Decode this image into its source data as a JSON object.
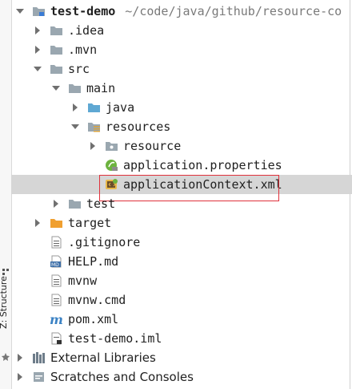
{
  "project": {
    "name": "test-demo",
    "path": "~/code/java/github/resource-co"
  },
  "tree": [
    {
      "label": "test-demo",
      "expanded": true,
      "icon": "module-folder-icon"
    },
    {
      "label": ".idea",
      "expanded": false,
      "icon": "folder-icon"
    },
    {
      "label": ".mvn",
      "expanded": false,
      "icon": "folder-icon"
    },
    {
      "label": "src",
      "expanded": true,
      "icon": "folder-icon"
    },
    {
      "label": "main",
      "expanded": true,
      "icon": "folder-icon"
    },
    {
      "label": "java",
      "expanded": false,
      "icon": "source-folder-icon"
    },
    {
      "label": "resources",
      "expanded": true,
      "icon": "resources-folder-icon"
    },
    {
      "label": "resource",
      "expanded": false,
      "icon": "package-folder-icon"
    },
    {
      "label": "application.properties",
      "icon": "spring-properties-icon"
    },
    {
      "label": "applicationContext.xml",
      "icon": "spring-xml-icon",
      "selected": true
    },
    {
      "label": "test",
      "expanded": false,
      "icon": "folder-icon"
    },
    {
      "label": "target",
      "expanded": false,
      "icon": "excluded-folder-icon"
    },
    {
      "label": ".gitignore",
      "icon": "text-file-icon"
    },
    {
      "label": "HELP.md",
      "icon": "markdown-file-icon"
    },
    {
      "label": "mvnw",
      "icon": "text-file-icon"
    },
    {
      "label": "mvnw.cmd",
      "icon": "text-file-icon"
    },
    {
      "label": "pom.xml",
      "icon": "maven-icon"
    },
    {
      "label": "test-demo.iml",
      "icon": "iml-file-icon"
    },
    {
      "label": "External Libraries",
      "expanded": false,
      "icon": "libraries-icon"
    },
    {
      "label": "Scratches and Consoles",
      "expanded": false,
      "icon": "scratches-icon"
    }
  ],
  "side_panel": {
    "label": "Z: Structure"
  },
  "colors": {
    "selection": "#d6d6d6",
    "highlight_border": "#e0323c",
    "folder": "#9aa7b0",
    "source_folder": "#5fa8d3",
    "excluded_folder": "#f0a030",
    "spring": "#6db33f"
  }
}
